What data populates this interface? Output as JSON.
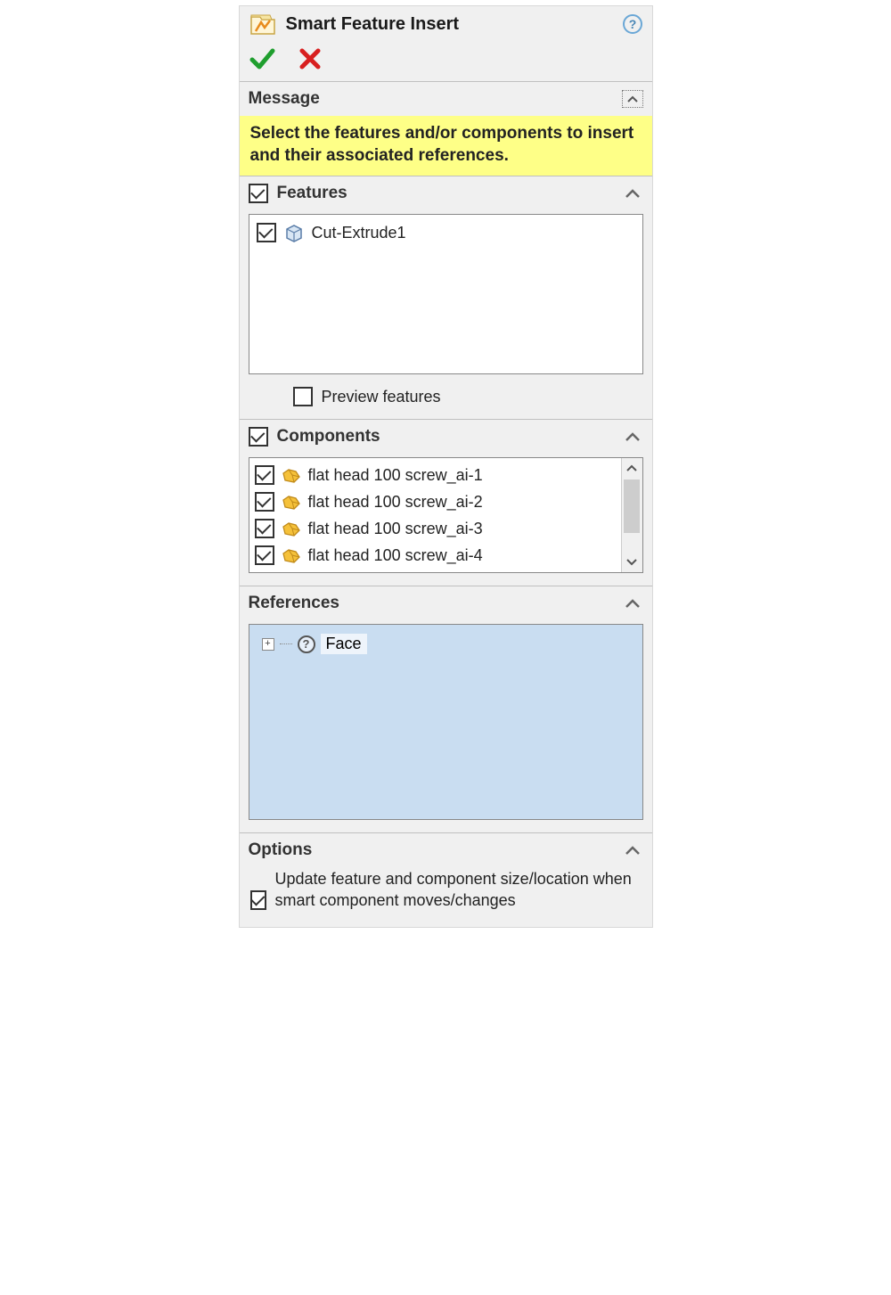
{
  "header": {
    "title": "Smart Feature Insert"
  },
  "sections": {
    "message": {
      "title": "Message",
      "body": "Select the features and/or components to insert and their associated references."
    },
    "features": {
      "title": "Features",
      "items": [
        {
          "label": "Cut-Extrude1",
          "checked": true
        }
      ],
      "preview_label": "Preview features",
      "preview_checked": false
    },
    "components": {
      "title": "Components",
      "items": [
        {
          "label": "flat head 100 screw_ai-1",
          "checked": true
        },
        {
          "label": "flat head 100 screw_ai-2",
          "checked": true
        },
        {
          "label": "flat head 100 screw_ai-3",
          "checked": true
        },
        {
          "label": "flat head 100 screw_ai-4",
          "checked": true
        }
      ]
    },
    "references": {
      "title": "References",
      "items": [
        {
          "label": "Face"
        }
      ]
    },
    "options": {
      "title": "Options",
      "update_label": "Update feature and component size/location when smart component moves/changes",
      "update_checked": true
    }
  }
}
